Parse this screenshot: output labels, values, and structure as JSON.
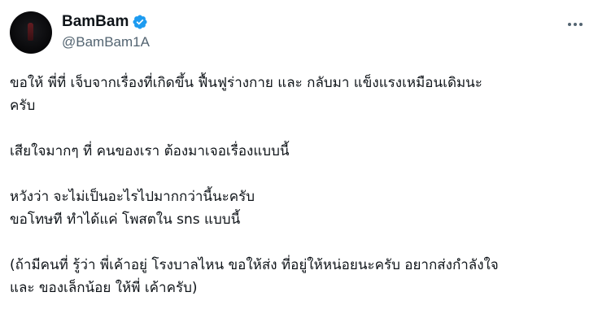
{
  "author": {
    "display_name": "BamBam",
    "handle": "@BamBam1A",
    "verified_icon": "verified-badge-icon",
    "verified_color": "#1d9bf0"
  },
  "menu": {
    "icon": "more-options-icon"
  },
  "tweet": {
    "paragraphs": [
      [
        "ขอให้ พี่ที่ เจ็บจากเรื่องที่เกิดขึ้น ฟื้นฟูร่างกาย และ กลับมา แข็งแรงเหมือนเดิมนะ",
        "ครับ"
      ],
      [
        "เสียใจมากๆ ที่ คนของเรา ต้องมาเจอเรื่องแบบนี้"
      ],
      [
        "หวังว่า จะไม่เป็นอะไรไปมากกว่านี้นะครับ",
        "ขอโทษที ทำได้แค่ โพสตใน sns แบบนี้"
      ],
      [
        "(ถ้ามีคนที่ รู้ว่า พี่เค้าอยู่ โรงบาลไหน ขอให้ส่ง ที่อยู่ให้หน่อยนะครับ อยากส่งกำลังใจ",
        "และ ของเล็กน้อย ให้พี่ เค้าครับ)"
      ]
    ]
  }
}
